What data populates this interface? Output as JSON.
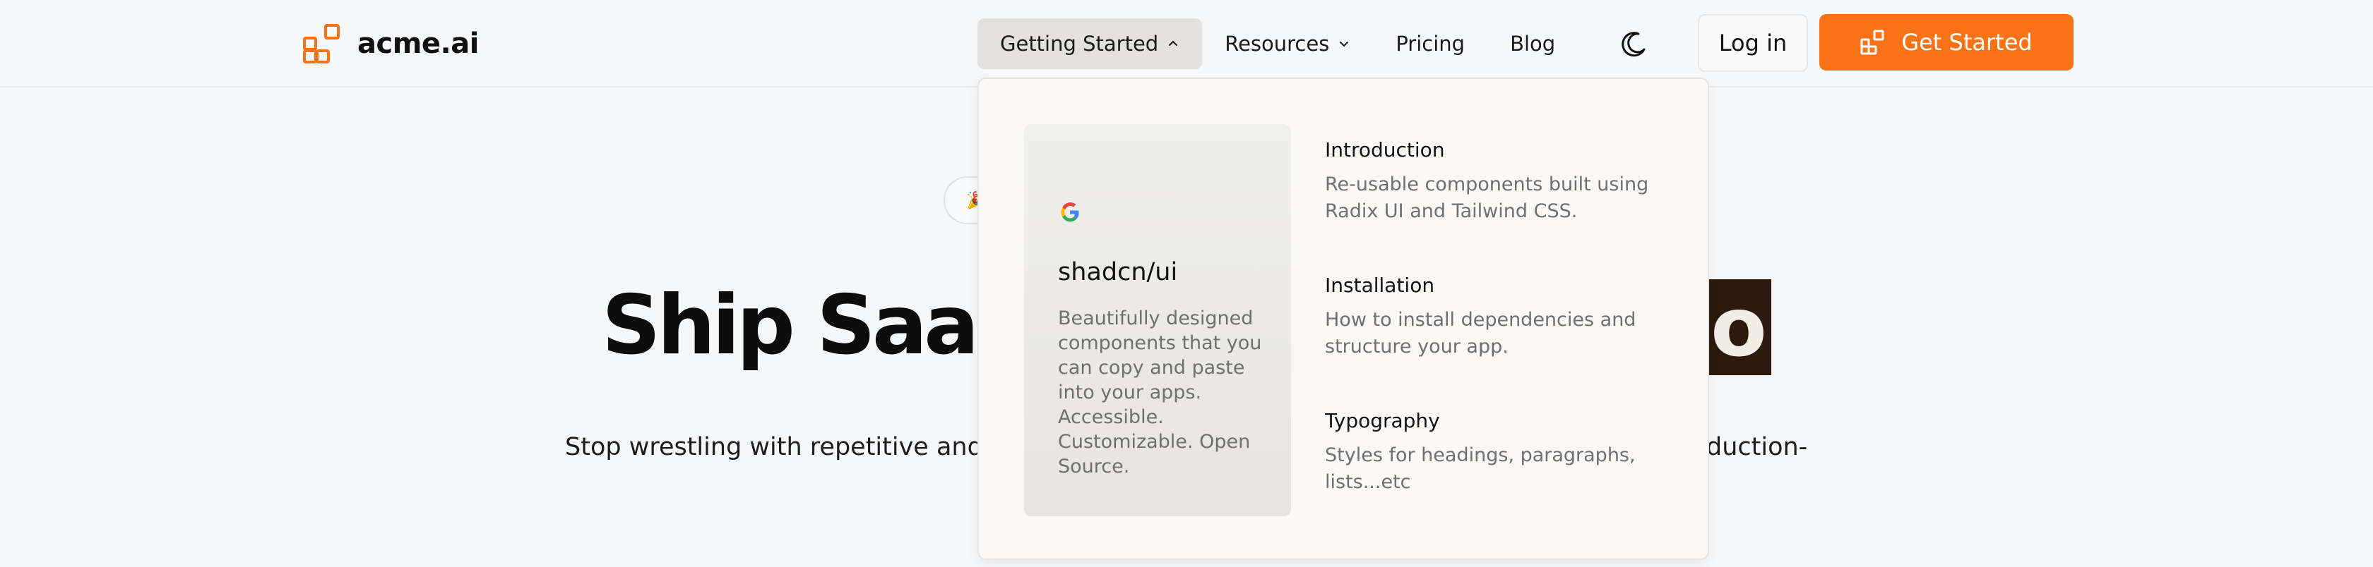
{
  "brand": {
    "name": "acme.ai",
    "accent": "#f97316"
  },
  "nav": {
    "items": [
      {
        "label": "Getting Started",
        "active": true,
        "has_dropdown": true
      },
      {
        "label": "Resources",
        "active": false,
        "has_dropdown": true
      },
      {
        "label": "Pricing",
        "active": false,
        "has_dropdown": false
      },
      {
        "label": "Blog",
        "active": false,
        "has_dropdown": false
      }
    ],
    "theme_toggle_icon": "moon-icon",
    "login_label": "Log in",
    "get_started_label": "Get Started"
  },
  "hero": {
    "title_left": "Ship SaaS",
    "title_right": "o",
    "subtitle_left": "Stop wrestling with repetitive and l",
    "subtitle_right": "duction-"
  },
  "dropdown": {
    "feature": {
      "icon": "google-icon",
      "title": "shadcn/ui",
      "description": "Beautifully designed components that you can copy and paste into your apps. Accessible. Customizable. Open Source."
    },
    "links": [
      {
        "title": "Introduction",
        "description": "Re-usable components built using Radix UI and Tailwind CSS."
      },
      {
        "title": "Installation",
        "description": "How to install dependencies and structure your app."
      },
      {
        "title": "Typography",
        "description": "Styles for headings, paragraphs, lists...etc"
      }
    ]
  }
}
